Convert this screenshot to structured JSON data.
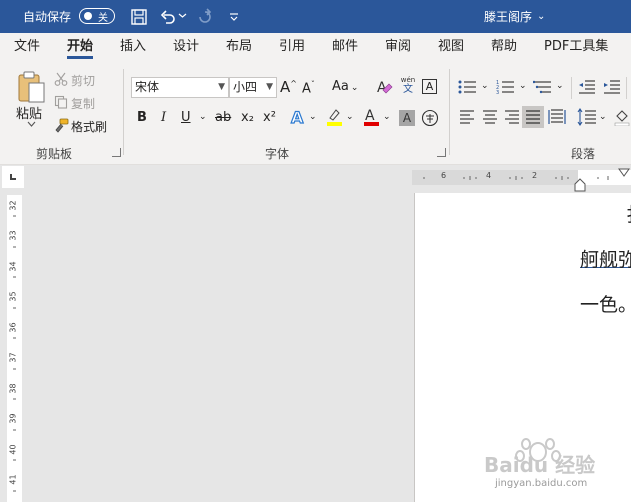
{
  "titlebar": {
    "autosave_label": "自动保存",
    "autosave_state": "关",
    "doc_title": "滕王阁序",
    "doc_title_arrow": "⌄"
  },
  "tabs": [
    {
      "label": "文件"
    },
    {
      "label": "开始",
      "active": true
    },
    {
      "label": "插入"
    },
    {
      "label": "设计"
    },
    {
      "label": "布局"
    },
    {
      "label": "引用"
    },
    {
      "label": "邮件"
    },
    {
      "label": "审阅"
    },
    {
      "label": "视图"
    },
    {
      "label": "帮助"
    },
    {
      "label": "PDF工具集"
    }
  ],
  "clipboard": {
    "paste_label": "粘贴",
    "cut_label": "剪切",
    "copy_label": "复制",
    "format_painter_label": "格式刷",
    "group_label": "剪贴板"
  },
  "font": {
    "font_name": "宋体",
    "font_size": "小四",
    "aa_label": "Aa",
    "phonetic_top": "wén",
    "phonetic_bottom": "文",
    "char_border": "A",
    "bold": "B",
    "italic": "I",
    "underline": "U",
    "strike": "ab",
    "subscript": "x₂",
    "superscript": "x²",
    "group_label": "字体"
  },
  "paragraph": {
    "group_label": "段落"
  },
  "ruler": {
    "h_numbers": [
      "6",
      "4",
      "2"
    ],
    "v_numbers": [
      "32",
      "33",
      "34",
      "35",
      "36",
      "37",
      "38",
      "39",
      "40",
      "41"
    ]
  },
  "document": {
    "line1": "扌",
    "line2": "舸舰弥",
    "line3": "一色。"
  },
  "watermark": {
    "text": "Baidu 经验",
    "url": "jingyan.baidu.com"
  },
  "colors": {
    "title_bar": "#2b579a",
    "highlight": "#ffff00",
    "font_color": "#e00000"
  }
}
